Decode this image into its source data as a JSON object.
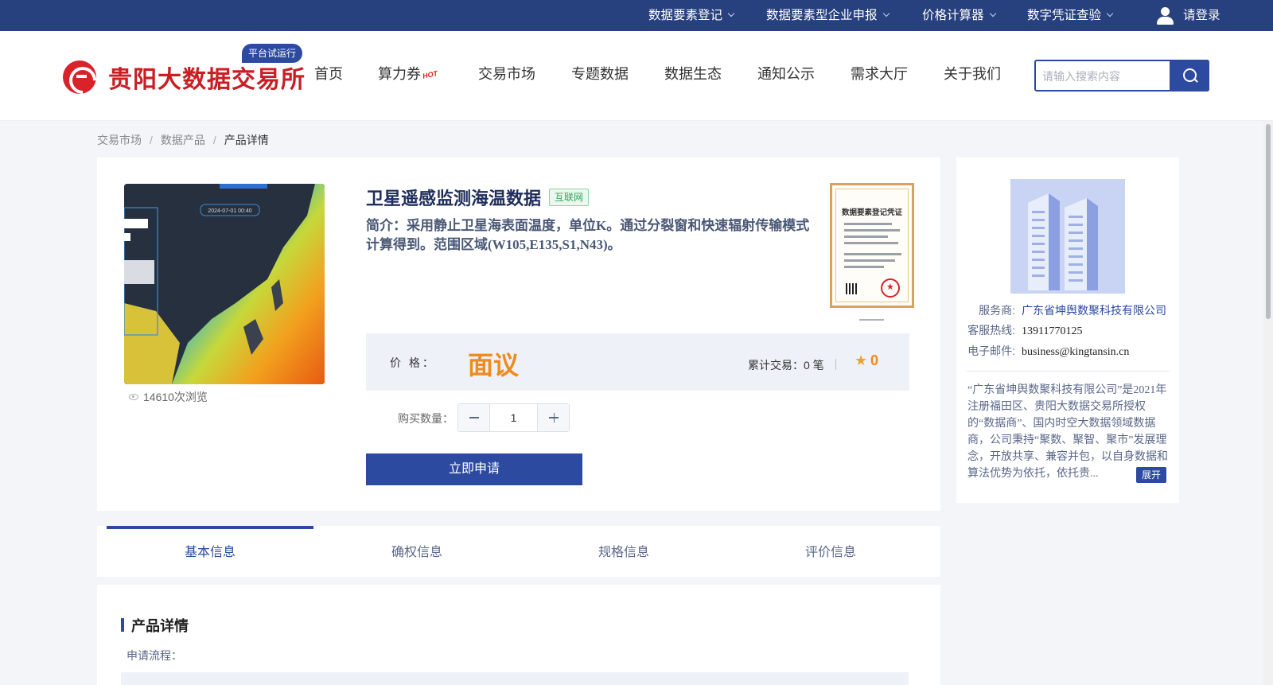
{
  "topbar": {
    "items": [
      {
        "label": "数据要素登记"
      },
      {
        "label": "数据要素型企业申报"
      },
      {
        "label": "价格计算器"
      },
      {
        "label": "数字凭证查验"
      }
    ],
    "login_label": "请登录"
  },
  "header": {
    "logo_text": "贵阳大数据交易所",
    "trial_badge": "平台试运行",
    "nav": [
      {
        "label": "首页"
      },
      {
        "label": "算力券",
        "badge": "HOT"
      },
      {
        "label": "交易市场"
      },
      {
        "label": "专题数据"
      },
      {
        "label": "数据生态"
      },
      {
        "label": "通知公示"
      },
      {
        "label": "需求大厅"
      },
      {
        "label": "关于我们"
      }
    ],
    "search_placeholder": "请输入搜索内容"
  },
  "breadcrumb": [
    "交易市场",
    "数据产品",
    "产品详情"
  ],
  "product": {
    "title": "卫星遥感监测海温数据",
    "tag": "互联网",
    "description": "简介：采用静止卫星海表面温度，单位K。通过分裂窗和快速辐射传输模式计算得到。范围区域(W105,E135,S1,N43)。",
    "views": "14610次浏览",
    "image_label": "2024-07-01 00:40",
    "certificate_title": "数据要素登记凭证",
    "price_label": "价  格：",
    "price_value": "面议",
    "trade_label": "累计交易：",
    "trade_count": "0 笔",
    "favorites": "0",
    "quantity_label": "购买数量：",
    "quantity": "1",
    "apply_button": "立即申请"
  },
  "provider": {
    "vendor_label": "服务商:",
    "vendor_name": "广东省坤舆数聚科技有限公司",
    "phone_label": "客服热线:",
    "phone": "13911770125",
    "email_label": "电子邮件:",
    "email": "business@kingtansin.cn",
    "intro": "“广东省坤舆数聚科技有限公司”是2021年注册福田区、贵阳大数据交易所授权的“数据商”、国内时空大数据领域数据商，公司秉持“聚数、聚智、聚市”发展理念，开放共享、兼容并包，以自身数据和算法优势为依托，依托贵...",
    "expand_label": "展开"
  },
  "tabs": [
    {
      "label": "基本信息",
      "active": true
    },
    {
      "label": "确权信息",
      "active": false
    },
    {
      "label": "规格信息",
      "active": false
    },
    {
      "label": "评价信息",
      "active": false
    }
  ],
  "details": {
    "section_title": "产品详情",
    "apply_flow_label": "申请流程："
  },
  "colors": {
    "brand_navy": "#27407e",
    "primary_blue": "#2b4aa0",
    "logo_red": "#c81e24",
    "price_orange": "#ef8a1e",
    "tag_green": "#36a35a"
  }
}
